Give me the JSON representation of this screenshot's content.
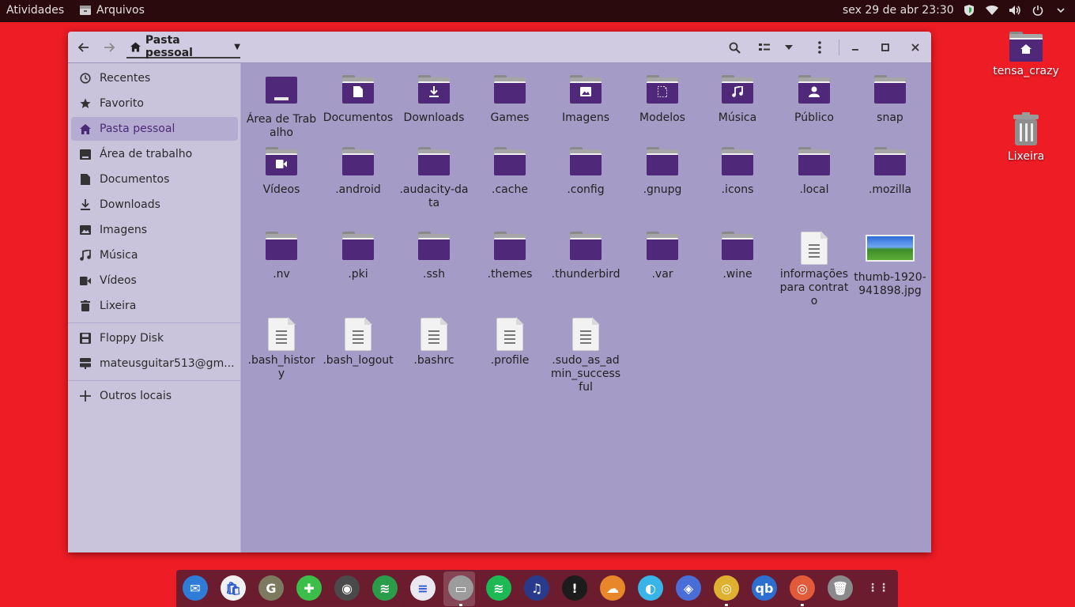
{
  "topbar": {
    "activities": "Atividades",
    "app_name": "Arquivos",
    "clock": "sex 29 de abr  23:30",
    "tray_icons": [
      "shield-icon",
      "wifi-icon",
      "volume-icon",
      "power-icon",
      "chevron-down-icon"
    ]
  },
  "window": {
    "path_label": "Pasta pessoal",
    "toolbar_icons": [
      "back-arrow-icon",
      "forward-arrow-icon",
      "search-icon",
      "list-view-icon",
      "view-options-icon",
      "menu-dots-icon",
      "minimize-icon",
      "maximize-icon",
      "close-icon"
    ]
  },
  "sidebar": {
    "items": [
      {
        "label": "Recentes",
        "icon": "clock-icon"
      },
      {
        "label": "Favorito",
        "icon": "star-icon"
      },
      {
        "label": "Pasta pessoal",
        "icon": "home-icon"
      },
      {
        "label": "Área de trabalho",
        "icon": "desktop-icon"
      },
      {
        "label": "Documentos",
        "icon": "document-icon"
      },
      {
        "label": "Downloads",
        "icon": "download-icon"
      },
      {
        "label": "Imagens",
        "icon": "image-icon"
      },
      {
        "label": "Música",
        "icon": "music-icon"
      },
      {
        "label": "Vídeos",
        "icon": "video-icon"
      },
      {
        "label": "Lixeira",
        "icon": "trash-icon"
      }
    ],
    "devices": [
      {
        "label": "Floppy Disk",
        "icon": "floppy-icon"
      },
      {
        "label": "mateusguitar513@gm...",
        "icon": "network-drive-icon"
      }
    ],
    "other": {
      "label": "Outros locais",
      "icon": "plus-icon"
    }
  },
  "files": [
    {
      "name": "Área de Trabalho",
      "kind": "desktop"
    },
    {
      "name": "Documentos",
      "kind": "folder",
      "emblem": "document"
    },
    {
      "name": "Downloads",
      "kind": "folder",
      "emblem": "download"
    },
    {
      "name": "Games",
      "kind": "folder"
    },
    {
      "name": "Imagens",
      "kind": "folder",
      "emblem": "image"
    },
    {
      "name": "Modelos",
      "kind": "folder",
      "emblem": "template"
    },
    {
      "name": "Música",
      "kind": "folder",
      "emblem": "music"
    },
    {
      "name": "Público",
      "kind": "folder",
      "emblem": "person"
    },
    {
      "name": "snap",
      "kind": "folder"
    },
    {
      "name": "Vídeos",
      "kind": "folder",
      "emblem": "video"
    },
    {
      "name": ".android",
      "kind": "folder"
    },
    {
      "name": ".audacity-data",
      "kind": "folder"
    },
    {
      "name": ".cache",
      "kind": "folder"
    },
    {
      "name": ".config",
      "kind": "folder"
    },
    {
      "name": ".gnupg",
      "kind": "folder"
    },
    {
      "name": ".icons",
      "kind": "folder"
    },
    {
      "name": ".local",
      "kind": "folder"
    },
    {
      "name": ".mozilla",
      "kind": "folder"
    },
    {
      "name": ".nv",
      "kind": "folder"
    },
    {
      "name": ".pki",
      "kind": "folder"
    },
    {
      "name": ".ssh",
      "kind": "folder"
    },
    {
      "name": ".themes",
      "kind": "folder"
    },
    {
      "name": ".thunderbird",
      "kind": "folder"
    },
    {
      "name": ".var",
      "kind": "folder"
    },
    {
      "name": ".wine",
      "kind": "folder"
    },
    {
      "name": "informações para contrato",
      "kind": "text"
    },
    {
      "name": "thumb-1920-941898.jpg",
      "kind": "image"
    },
    {
      "name": ".bash_history",
      "kind": "text"
    },
    {
      "name": ".bash_logout",
      "kind": "text"
    },
    {
      "name": ".bashrc",
      "kind": "text"
    },
    {
      "name": ".profile",
      "kind": "text"
    },
    {
      "name": ".sudo_as_admin_successful",
      "kind": "text"
    }
  ],
  "desktop": {
    "items": [
      {
        "label": "tensa_crazy",
        "icon": "home-folder-icon"
      },
      {
        "label": "Lixeira",
        "icon": "trash-icon"
      }
    ]
  },
  "dock": {
    "apps": [
      {
        "name": "thunderbird-icon",
        "color": "#2f7bd8",
        "glyph": "✉"
      },
      {
        "name": "software-center-icon",
        "color": "#f0f0f0",
        "glyph": "🛍"
      },
      {
        "name": "gimp-icon",
        "color": "#7e7a5f",
        "glyph": "G"
      },
      {
        "name": "extensions-icon",
        "color": "#3cbf4a",
        "glyph": "✚"
      },
      {
        "name": "disk-usage-icon",
        "color": "#4a4a4a",
        "glyph": "◉"
      },
      {
        "name": "system-monitor-icon",
        "color": "#2a9d4a",
        "glyph": "≋"
      },
      {
        "name": "text-editor-icon",
        "color": "#e8e8ee",
        "glyph": "≡"
      },
      {
        "name": "files-icon",
        "color": "#9c9c9c",
        "glyph": "▭"
      },
      {
        "name": "spotify-icon",
        "color": "#1db954",
        "glyph": "≋"
      },
      {
        "name": "audacity-icon",
        "color": "#2a3a8a",
        "glyph": "♫"
      },
      {
        "name": "game-launcher-icon",
        "color": "#1c1c1c",
        "glyph": "!"
      },
      {
        "name": "cloud-app-icon",
        "color": "#e8862a",
        "glyph": "☁"
      },
      {
        "name": "prism-app-icon",
        "color": "#39b4e8",
        "glyph": "◐"
      },
      {
        "name": "waveform-app-icon",
        "color": "#4a6ed8",
        "glyph": "◈"
      },
      {
        "name": "chrome-icon",
        "color": "#e0b030",
        "glyph": "◎"
      },
      {
        "name": "qbittorrent-icon",
        "color": "#2d6fd0",
        "glyph": "qb"
      },
      {
        "name": "chromium-icon",
        "color": "#e25a3a",
        "glyph": "◎"
      },
      {
        "name": "trash-icon",
        "color": "#8a8a8a",
        "glyph": "🗑"
      },
      {
        "name": "app-grid-icon",
        "color": "transparent",
        "glyph": "⋮⋮"
      }
    ]
  }
}
